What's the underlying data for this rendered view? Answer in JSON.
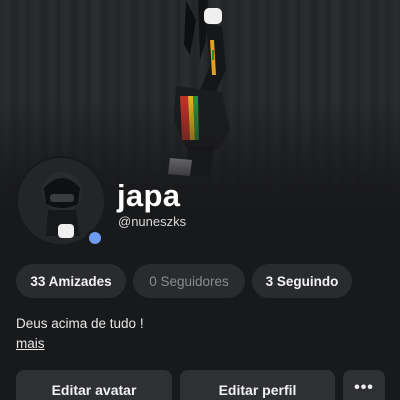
{
  "profile": {
    "display_name": "japa",
    "username": "@nuneszks",
    "online_status_color": "#6f9cf3"
  },
  "stats": {
    "friends": "33 Amizades",
    "followers": "0 Seguidores",
    "following": "3 Seguindo"
  },
  "bio": {
    "text": "Deus acima de tudo !",
    "more_link": "mais"
  },
  "actions": {
    "edit_avatar": "Editar avatar",
    "edit_profile": "Editar perfil",
    "more_options": "•••"
  },
  "icons": {
    "more_options": "ellipsis-icon"
  }
}
